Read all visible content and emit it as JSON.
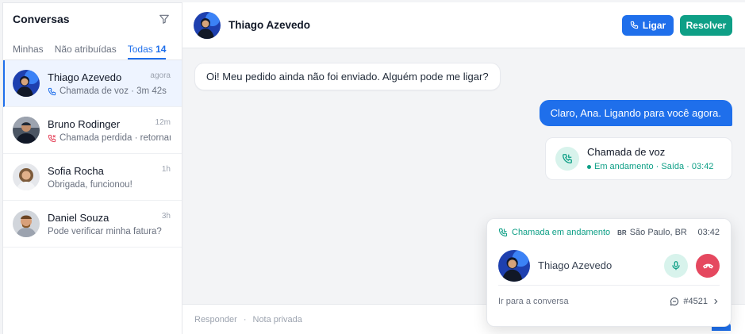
{
  "sidebar": {
    "title": "Conversas",
    "tabs": [
      {
        "label": "Minhas"
      },
      {
        "label": "Não atribuídas"
      },
      {
        "label": "Todas",
        "count": "14"
      }
    ],
    "conversations": [
      {
        "name": "Thiago Azevedo",
        "time": "agora",
        "preview": "Chamada de voz · 3m 42s",
        "icon": "phone-icon",
        "active": true
      },
      {
        "name": "Bruno Rodinger",
        "time": "12m",
        "preview": "Chamada perdida · retornar?",
        "icon": "missed-call-icon"
      },
      {
        "name": "Sofia Rocha",
        "time": "1h",
        "preview": "Obrigada, funcionou!"
      },
      {
        "name": "Daniel Souza",
        "time": "3h",
        "preview": "Pode verificar minha fatura?"
      }
    ]
  },
  "header": {
    "contact_name": "Thiago Azevedo",
    "call_button": "Ligar",
    "resolve_button": "Resolver"
  },
  "messages": {
    "incoming": "Oi! Meu pedido ainda não foi enviado. Alguém pode me ligar?",
    "outgoing": "Claro, Ana. Ligando para você agora."
  },
  "call_card": {
    "title": "Chamada de voz",
    "status": "Em andamento · Saída · 03:42"
  },
  "composer": {
    "reply": "Responder",
    "separator": "·",
    "private_note": "Nota privada"
  },
  "call_widget": {
    "status": "Chamada em andamento",
    "country_code": "BR",
    "location": "São Paulo, BR",
    "timer": "03:42",
    "contact_name": "Thiago Azevedo",
    "goto_label": "Ir para a conversa",
    "ticket": "#4521"
  },
  "colors": {
    "primary": "#1f6feb",
    "success": "#0e9f86",
    "danger": "#e5485f",
    "missed": "#e5485f"
  }
}
